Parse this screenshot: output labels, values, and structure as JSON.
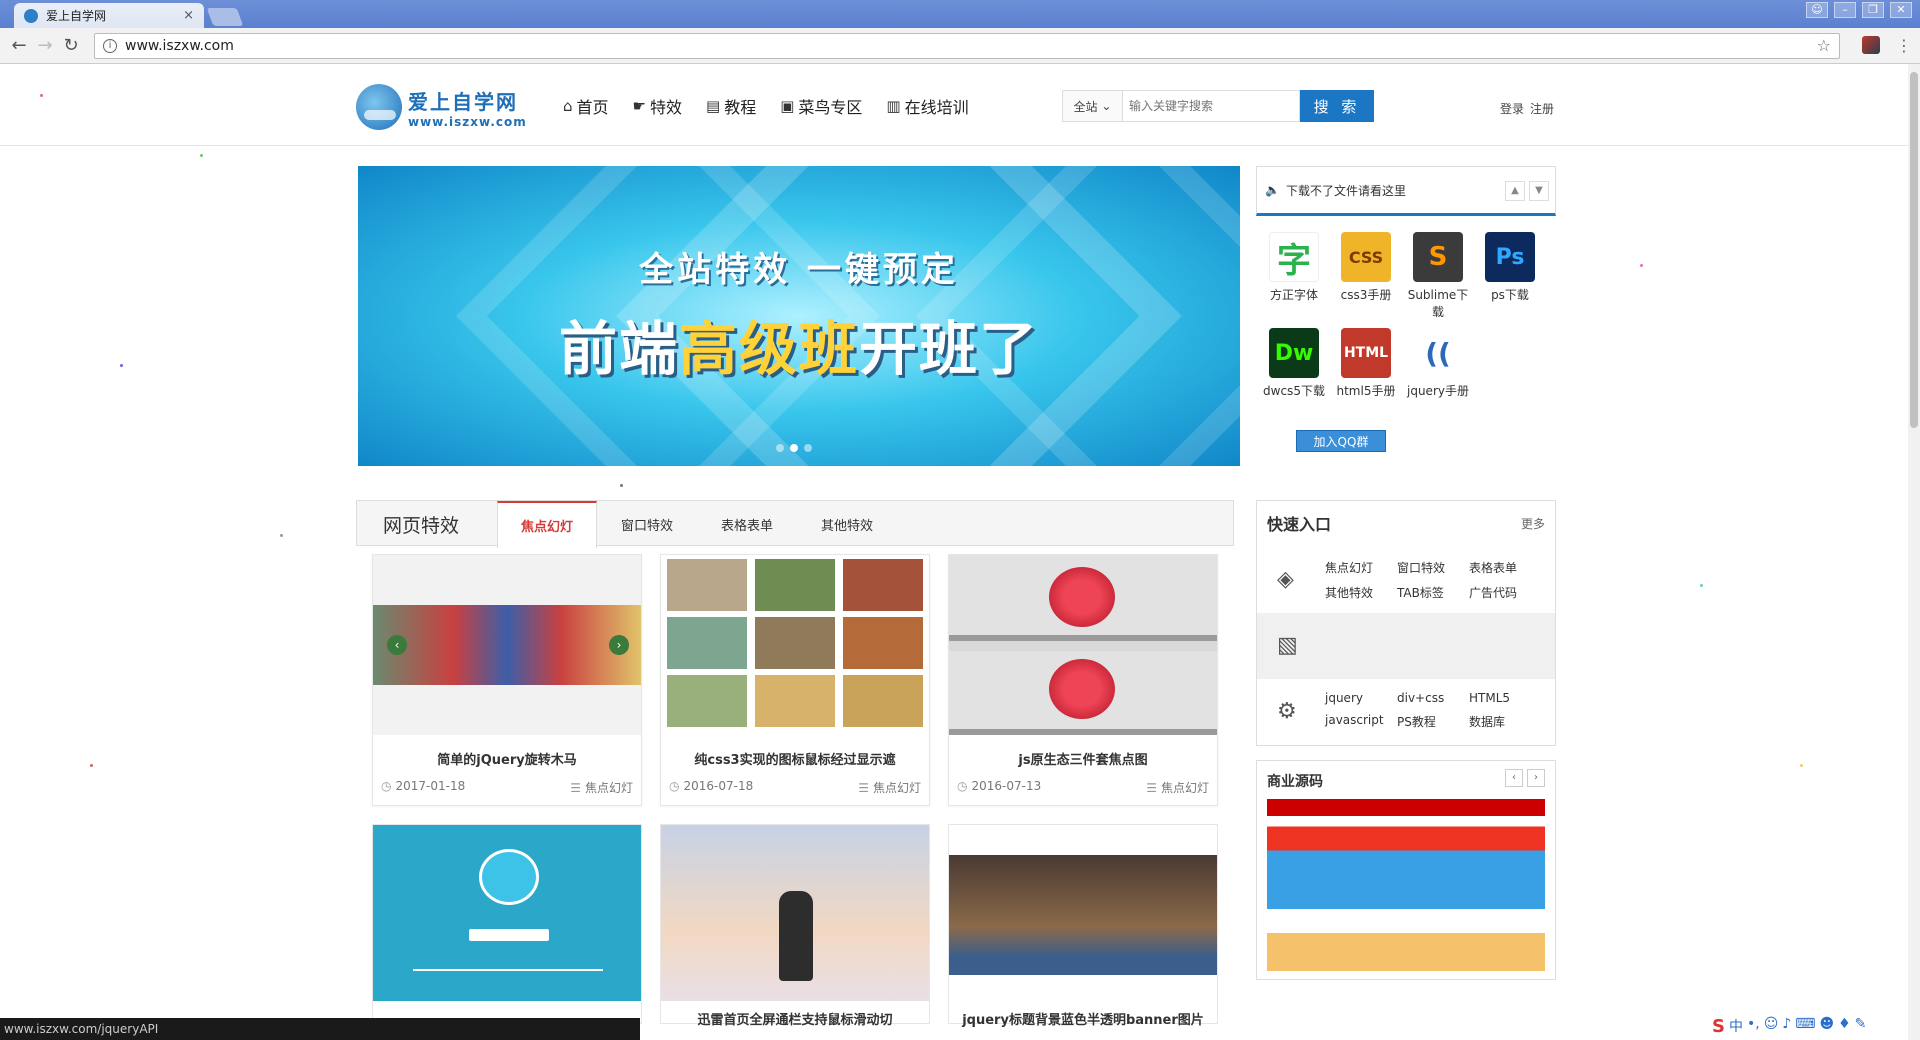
{
  "browser": {
    "tab_title": "爱上自学网",
    "tab_close": "×",
    "url": "www.iszxw.com",
    "status_url": "www.iszxw.com/jqueryAPI"
  },
  "header": {
    "logo_cn": "爱上自学网",
    "logo_url": "www.iszxw.com",
    "nav": [
      {
        "label": "首页",
        "icon": "home-icon"
      },
      {
        "label": "特效",
        "icon": "hand-icon"
      },
      {
        "label": "教程",
        "icon": "book-icon"
      },
      {
        "label": "菜鸟专区",
        "icon": "briefcase-icon"
      },
      {
        "label": "在线培训",
        "icon": "library-icon"
      }
    ],
    "search_scope": "全站",
    "search_placeholder": "输入关键字搜索",
    "search_button": "搜 索",
    "login": "登录",
    "register": "注册"
  },
  "banner": {
    "line1": "全站特效  一键预定",
    "line2_a": "前端",
    "line2_hl": "高级班",
    "line2_b": "开班了",
    "active_slide": 2,
    "slides": 3
  },
  "notice": {
    "text": "下载不了文件请看这里"
  },
  "tools": [
    {
      "label": "方正字体",
      "glyph": "字",
      "color": "#ffffff",
      "fg": "#2bb24c"
    },
    {
      "label": "css3手册",
      "glyph": "CSS",
      "color": "#f0b429",
      "fg": "#7a3b00"
    },
    {
      "label": "Sublime下载",
      "glyph": "S",
      "color": "#3b3b3b",
      "fg": "#ff9800"
    },
    {
      "label": "ps下载",
      "glyph": "Ps",
      "color": "#0d2a5e",
      "fg": "#31a8ff"
    },
    {
      "label": "dwcs5下载",
      "glyph": "Dw",
      "color": "#0b3a18",
      "fg": "#35fa00"
    },
    {
      "label": "html5手册",
      "glyph": "HTML",
      "color": "#c0392b",
      "fg": "#ffffff"
    },
    {
      "label": "jquery手册",
      "glyph": "((",
      "color": "#ffffff",
      "fg": "#2c6ab7"
    }
  ],
  "qq_button": "加入QQ群",
  "effects": {
    "title": "网页特效",
    "tabs": [
      "焦点幻灯",
      "窗口特效",
      "表格表单",
      "其他特效"
    ],
    "active_tab": 0,
    "cards": [
      {
        "title": "简单的jQuery旋转木马",
        "date": "2017-01-18",
        "category": "焦点幻灯"
      },
      {
        "title": "纯css3实现的图标鼠标经过显示遮",
        "date": "2016-07-18",
        "category": "焦点幻灯"
      },
      {
        "title": "js原生态三件套焦点图",
        "date": "2016-07-13",
        "category": "焦点幻灯"
      }
    ],
    "cards_row2": [
      {
        "title": ""
      },
      {
        "title": "迅雷首页全屏通栏支持鼠标滑动切"
      },
      {
        "title": "jquery标题背景蓝色半透明banner图片"
      }
    ]
  },
  "quick": {
    "title": "快速入口",
    "more": "更多",
    "row1": [
      "焦点幻灯",
      "窗口特效",
      "表格表单",
      "其他特效",
      "TAB标签",
      "广告代码"
    ],
    "row3": [
      "jquery",
      "div+css",
      "HTML5",
      "javascript",
      "PS教程",
      "数据库"
    ]
  },
  "biz": {
    "title": "商业源码"
  },
  "colors": {
    "brand": "#1b76c4",
    "accent_red": "#d63b3b"
  }
}
